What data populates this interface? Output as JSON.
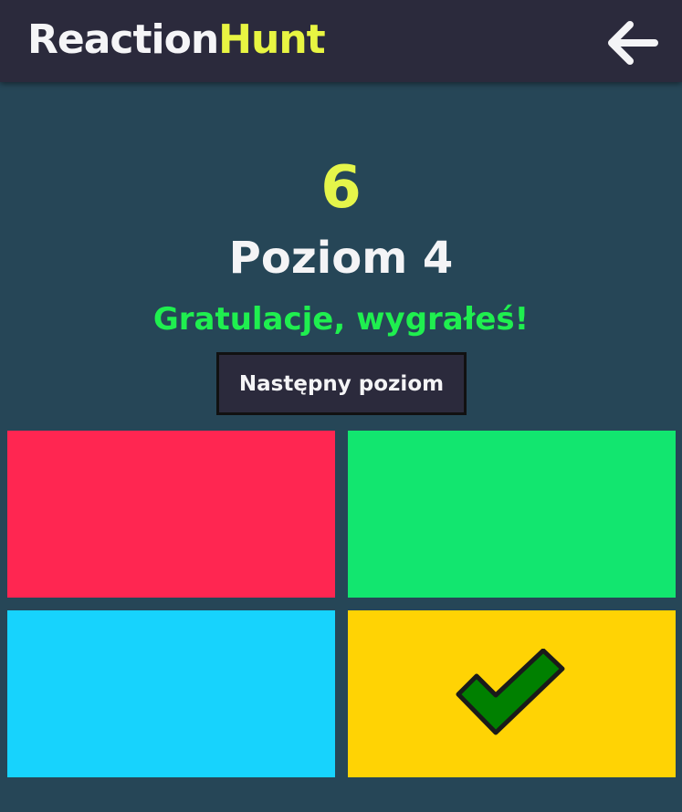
{
  "header": {
    "logo_part1": "Reaction",
    "logo_part2": "Hunt",
    "back_icon": "arrow-left-icon"
  },
  "game": {
    "score": "6",
    "level": "Poziom 4",
    "message": "Gratulacje, wygrałeś!",
    "next_button_label": "Następny poziom"
  },
  "tiles": [
    {
      "color": "#ff2651",
      "selected": false
    },
    {
      "color": "#12e66f",
      "selected": false
    },
    {
      "color": "#17d3fd",
      "selected": false
    },
    {
      "color": "#ffd304",
      "selected": true,
      "icon": "checkmark-icon"
    }
  ],
  "colors": {
    "background": "#264657",
    "header": "#2b2a3c",
    "accent_yellow": "#e8f542",
    "success_green": "#1fef4f",
    "check_green": "#008000"
  }
}
